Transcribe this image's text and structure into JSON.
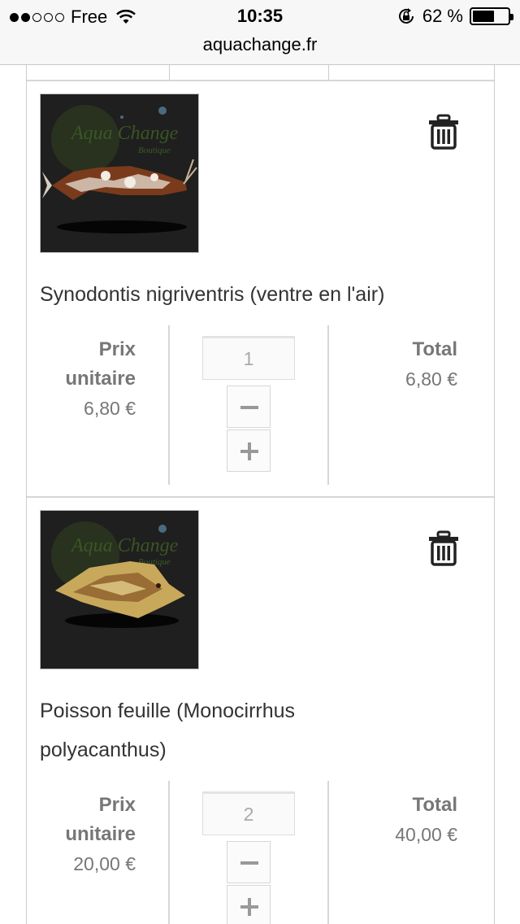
{
  "status_bar": {
    "carrier": "Free",
    "time": "10:35",
    "battery": "62 %",
    "battery_level": 0.62
  },
  "browser": {
    "url": "aquachange.fr"
  },
  "colors": {
    "border": "#d6d6d6",
    "muted_text": "#777777",
    "text": "#333333"
  },
  "cart": {
    "items": [
      {
        "name": "Synodontis nigriventris (ventre en l'air)",
        "unit_price_label": "Prix unitaire",
        "unit_price": "6,80 €",
        "quantity": "1",
        "total_label": "Total",
        "total": "6,80 €",
        "delete_icon": "trash-icon"
      },
      {
        "name": "Poisson feuille (Monocirrhus polyacanthus)",
        "unit_price_label": "Prix unitaire",
        "unit_price": "20,00 €",
        "quantity": "2",
        "total_label": "Total",
        "total": "40,00 €",
        "delete_icon": "trash-icon"
      }
    ]
  }
}
